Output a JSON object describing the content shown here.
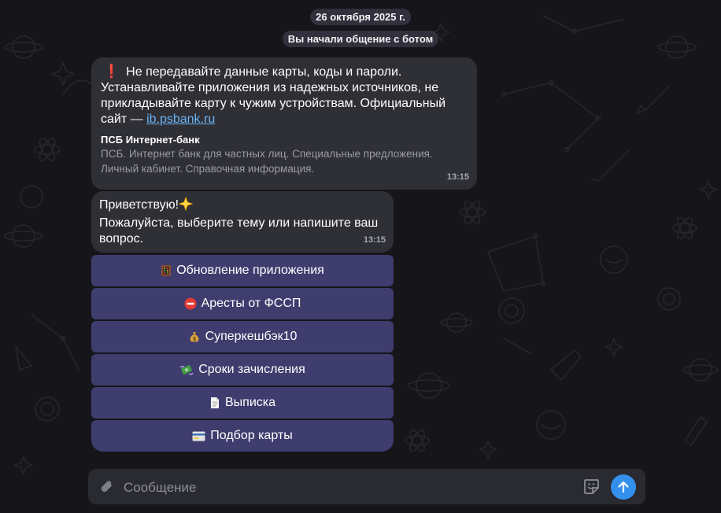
{
  "date_label": "26 октября 2025 г.",
  "service_message": "Вы начали общение с ботом",
  "warning_message": {
    "icon": "exclamation-icon",
    "text": "Не передавайте данные карты, коды и пароли. Устанавливайте приложения из надежных источников, не прикладывайте карту к чужим устройствам. Официальный сайт — ",
    "link_text": "ib.psbank.ru",
    "preview_title": "ПСБ Интернет-банк",
    "preview_description": "ПСБ. Интернет банк для частных лиц. Специальные предложения. Личный кабинет. Справочная информация.",
    "time": "13:15"
  },
  "greeting_message": {
    "line1": "Приветствую!",
    "line1_icon": "sparkle-star-icon",
    "line2": "Пожалуйста, выберите тему или напишите ваш вопрос.",
    "time": "13:15"
  },
  "keyboard_buttons": [
    {
      "icon": "abacus-icon",
      "label": "Обновление приложения"
    },
    {
      "icon": "no-entry-icon",
      "label": "Аресты от ФССП"
    },
    {
      "icon": "money-bag-icon",
      "label": "Суперкешбэк10"
    },
    {
      "icon": "flying-money-icon",
      "label": "Сроки зачисления"
    },
    {
      "icon": "document-icon",
      "label": "Выписка"
    },
    {
      "icon": "credit-card-icon",
      "label": "Подбор карты"
    }
  ],
  "composer": {
    "placeholder": "Сообщение",
    "attach_icon": "paperclip-icon",
    "sticker_icon": "sticker-icon",
    "send_icon": "arrow-up-icon"
  },
  "colors": {
    "background": "#15151a",
    "bubble": "#2f2f36",
    "keyboard_button": "#3f3d6e",
    "link": "#6ab3f3",
    "send_button": "#3390ec"
  }
}
